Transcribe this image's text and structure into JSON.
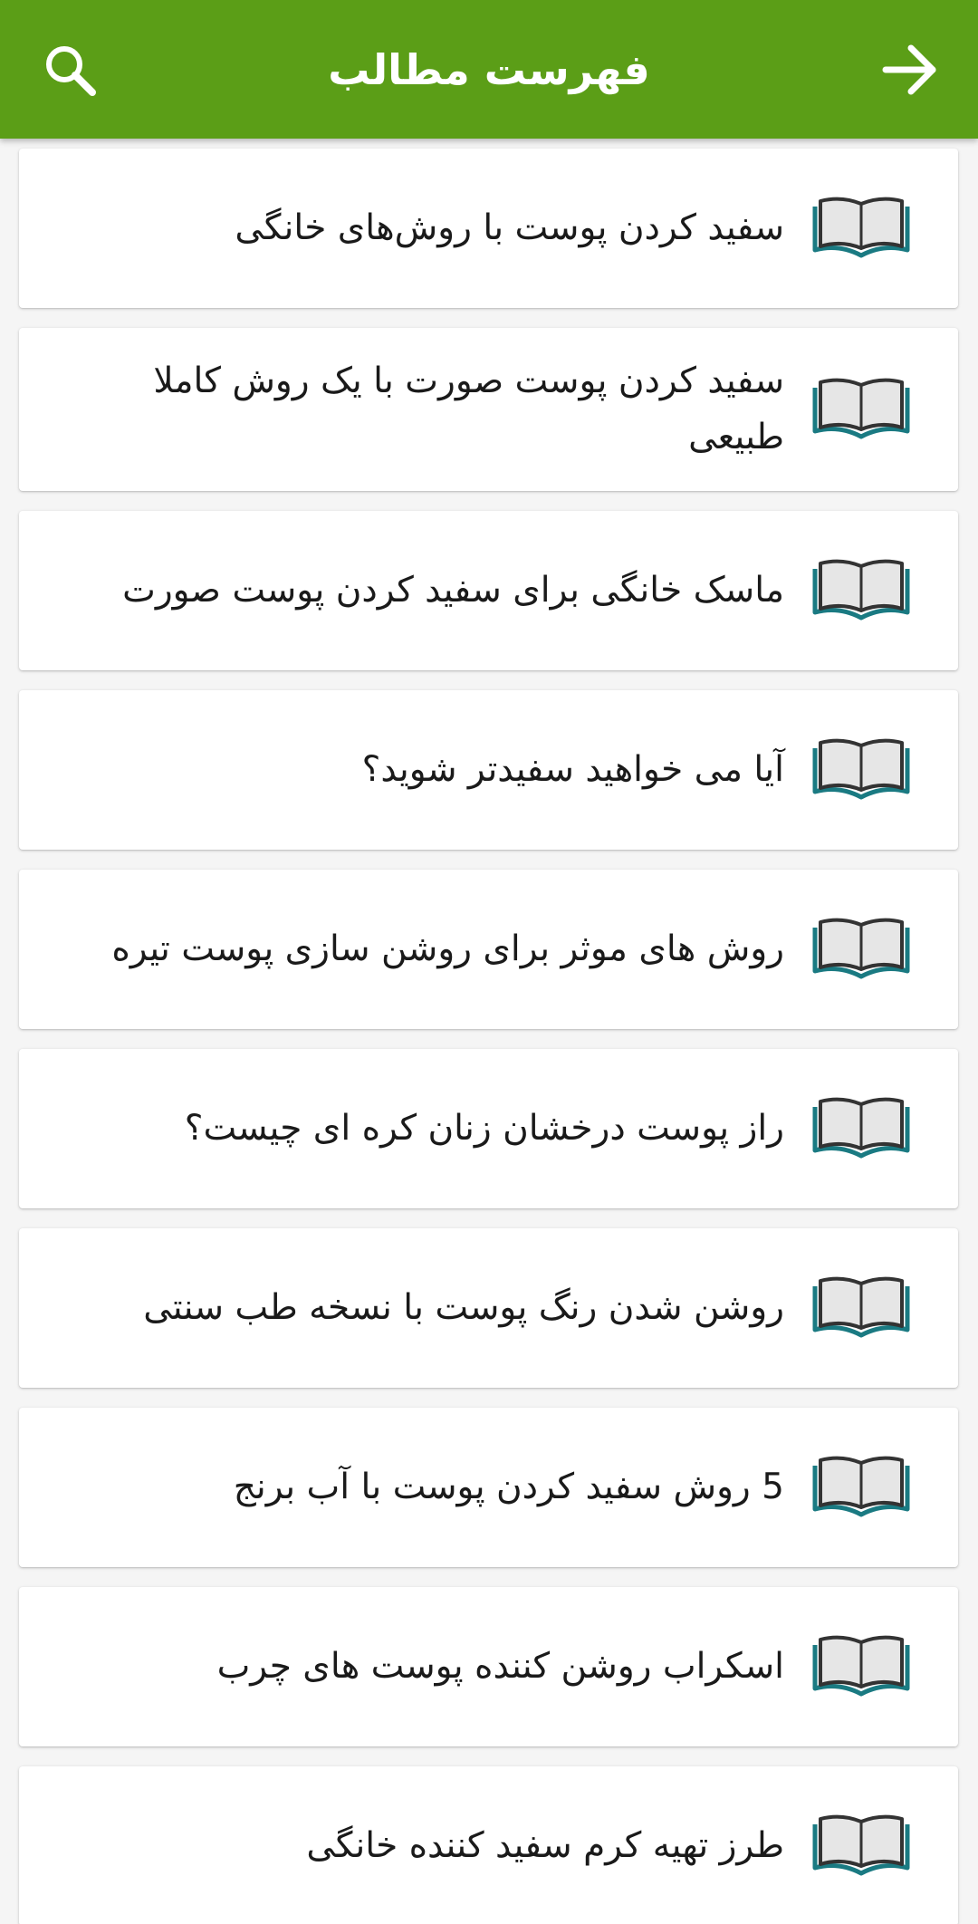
{
  "toolbar": {
    "title": "فهرست مطالب",
    "search_icon": "search-icon",
    "back_icon": "arrow-right-icon",
    "bg_color": "#5b9e17"
  },
  "items": [
    {
      "label": "سفید کردن پوست با روش‌های خانگی"
    },
    {
      "label": "سفید کردن پوست صورت با یک روش کاملا طبیعی"
    },
    {
      "label": "ماسک خانگی برای سفید کردن پوست صورت"
    },
    {
      "label": "آیا می خواهید سفیدتر شوید؟"
    },
    {
      "label": "روش های موثر برای روشن سازی پوست تیره"
    },
    {
      "label": "راز پوست درخشان زنان کره ای چیست؟"
    },
    {
      "label": "روشن شدن رنگ پوست با نسخه طب سنتی"
    },
    {
      "label": "5 روش سفید کردن پوست با آب برنج"
    },
    {
      "label": "اسکراب روشن کننده پوست های چرب"
    },
    {
      "label": "طرز تهیه کرم سفید کننده خانگی"
    }
  ],
  "item_icon": "open-book-icon"
}
